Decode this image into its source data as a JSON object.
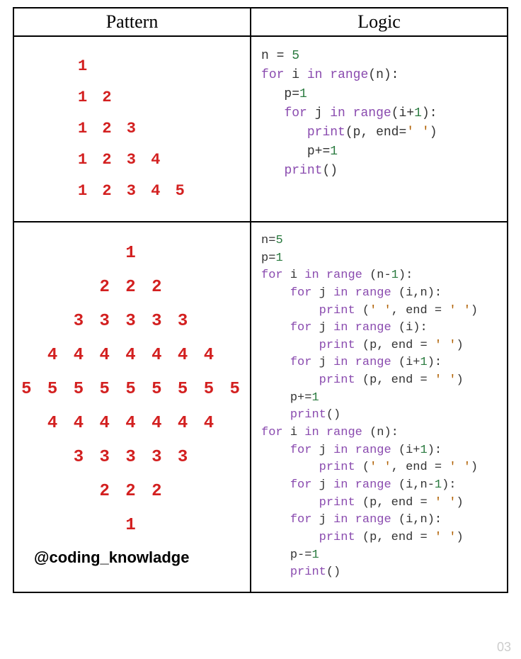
{
  "headers": {
    "pattern": "Pattern",
    "logic": "Logic"
  },
  "row1": {
    "pattern": {
      "l1": "1",
      "l2": "1 2",
      "l3": "1 2 3",
      "l4": "1 2 3 4",
      "l5": "1 2 3 4 5"
    },
    "code": {
      "l1a": "n ",
      "l1b": "=",
      "l1c": " ",
      "l1d": "5",
      "l2a": "for",
      "l2b": " i ",
      "l2c": "in",
      "l2d": " ",
      "l2e": "range",
      "l2f": "(n):",
      "l3": "   p=",
      "l3b": "1",
      "l4a": "   ",
      "l4b": "for",
      "l4c": " j ",
      "l4d": "in",
      "l4e": " ",
      "l4f": "range",
      "l4g": "(i+",
      "l4h": "1",
      "l4i": "):",
      "l5a": "      ",
      "l5b": "print",
      "l5c": "(p, end=",
      "l5d": "' '",
      "l5e": ")",
      "l6": "      p+=",
      "l6b": "1",
      "l7a": "   ",
      "l7b": "print",
      "l7c": "()"
    }
  },
  "row2": {
    "pattern": {
      "l1": "1",
      "l2": "2 2 2",
      "l3": "3 3 3 3 3",
      "l4": "4 4 4 4 4 4 4",
      "l5": "5 5 5 5 5 5 5 5 5",
      "l6": "4 4 4 4 4 4 4",
      "l7": "3 3 3 3 3",
      "l8": "2 2 2",
      "l9": "1"
    },
    "code": {
      "a1": "n=",
      "a1b": "5",
      "a2": "p=",
      "a2b": "1",
      "a3a": "for",
      "a3b": " i ",
      "a3c": "in",
      "a3d": " ",
      "a3e": "range",
      "a3f": " (n-",
      "a3g": "1",
      "a3h": "):",
      "a4a": "    ",
      "a4b": "for",
      "a4c": " j ",
      "a4d": "in",
      "a4e": " ",
      "a4f": "range",
      "a4g": " (i,n):",
      "a5a": "        ",
      "a5b": "print",
      "a5c": " (",
      "a5d": "' '",
      "a5e": ", end = ",
      "a5f": "' '",
      "a5g": ")",
      "a6a": "    ",
      "a6b": "for",
      "a6c": " j ",
      "a6d": "in",
      "a6e": " ",
      "a6f": "range",
      "a6g": " (i):",
      "a7a": "        ",
      "a7b": "print",
      "a7c": " (p, end = ",
      "a7d": "' '",
      "a7e": ")",
      "a8a": "    ",
      "a8b": "for",
      "a8c": " j ",
      "a8d": "in",
      "a8e": " ",
      "a8f": "range",
      "a8g": " (i+",
      "a8h": "1",
      "a8i": "):",
      "a9a": "        ",
      "a9b": "print",
      "a9c": " (p, end = ",
      "a9d": "' '",
      "a9e": ")",
      "a10": "    p+=",
      "a10b": "1",
      "a11a": "    ",
      "a11b": "print",
      "a11c": "()",
      "b1a": "for",
      "b1b": " i ",
      "b1c": "in",
      "b1d": " ",
      "b1e": "range",
      "b1f": " (n):",
      "b2a": "    ",
      "b2b": "for",
      "b2c": " j ",
      "b2d": "in",
      "b2e": " ",
      "b2f": "range",
      "b2g": " (i+",
      "b2h": "1",
      "b2i": "):",
      "b3a": "        ",
      "b3b": "print",
      "b3c": " (",
      "b3d": "' '",
      "b3e": ", end = ",
      "b3f": "' '",
      "b3g": ")",
      "b4a": "    ",
      "b4b": "for",
      "b4c": " j ",
      "b4d": "in",
      "b4e": " ",
      "b4f": "range",
      "b4g": " (i,n-",
      "b4h": "1",
      "b4i": "):",
      "b5a": "        ",
      "b5b": "print",
      "b5c": " (p, end = ",
      "b5d": "' '",
      "b5e": ")",
      "b6a": "    ",
      "b6b": "for",
      "b6c": " j ",
      "b6d": "in",
      "b6e": " ",
      "b6f": "range",
      "b6g": " (i,n):",
      "b7a": "        ",
      "b7b": "print",
      "b7c": " (p, end = ",
      "b7d": "' '",
      "b7e": ")",
      "b8": "    p-=",
      "b8b": "1",
      "b9a": "    ",
      "b9b": "print",
      "b9c": "()"
    }
  },
  "handle": "@coding_knowladge",
  "pagenum": "03"
}
